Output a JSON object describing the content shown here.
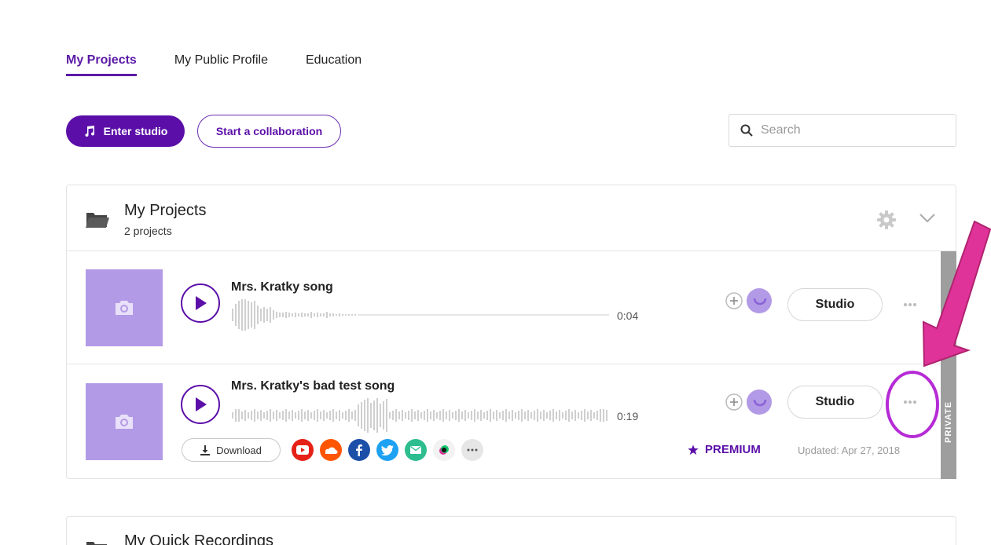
{
  "tabs": [
    {
      "label": "My Projects",
      "active": true
    },
    {
      "label": "My Public Profile",
      "active": false
    },
    {
      "label": "Education",
      "active": false
    }
  ],
  "actions": {
    "enter_studio": "Enter studio",
    "start_collab": "Start a collaboration"
  },
  "search": {
    "placeholder": "Search"
  },
  "projects_card": {
    "title": "My Projects",
    "subtitle": "2 projects",
    "rows": [
      {
        "title": "Mrs. Kratky song",
        "duration": "0:04",
        "studio_label": "Studio"
      },
      {
        "title": "Mrs. Kratky's bad test song",
        "duration": "0:19",
        "studio_label": "Studio",
        "download_label": "Download",
        "premium_label": "PREMIUM",
        "updated": "Updated: Apr 27, 2018",
        "visibility": "PRIVATE"
      }
    ]
  },
  "quick_card": {
    "title": "My Quick Recordings"
  },
  "colors": {
    "accent": "#5b0fa8",
    "thumb": "#b39ae6",
    "annotation_pink": "#e0339a",
    "youtube": "#e62117",
    "soundcloud": "#ff5500",
    "facebook": "#1b4fa8",
    "twitter": "#1da1f2",
    "email": "#2ebd8f"
  },
  "icons": [
    "music-note-icon",
    "search-icon",
    "folder-icon",
    "gear-icon",
    "chevron-down-icon",
    "camera-icon",
    "play-icon",
    "add-collaborator-icon",
    "more-icon",
    "download-icon",
    "youtube-icon",
    "soundcloud-icon",
    "facebook-icon",
    "twitter-icon",
    "email-icon",
    "bandlab-icon",
    "star-icon"
  ]
}
